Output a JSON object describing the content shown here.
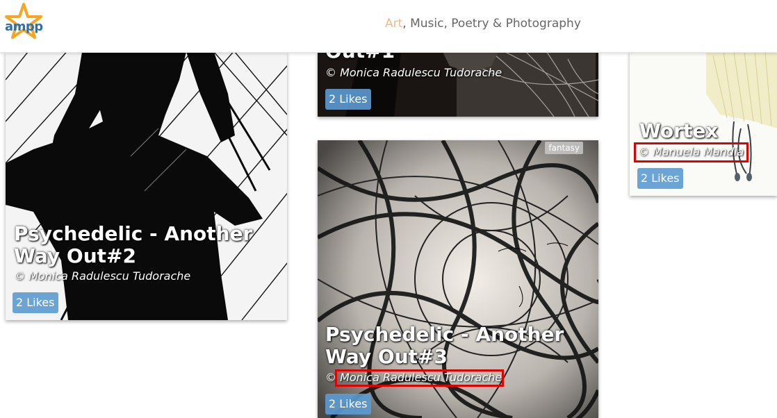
{
  "header": {
    "logo_text": "ampp",
    "nav": {
      "art": "Art",
      "separator": ",",
      "rest": " Music, Poetry & Photography"
    }
  },
  "cards": [
    {
      "title": "Psychedelic - Another Way Out#2",
      "author": "© Monica Radulescu Tudorache",
      "likes": "2 Likes"
    },
    {
      "title_fragment": "Out#1",
      "author": "© Monica Radulescu Tudorache",
      "likes": "2 Likes"
    },
    {
      "title": "Psychedelic - Another Way Out#3",
      "author": "© Monica Radulescu Tudorache",
      "likes": "2 Likes",
      "tag": "fantasy"
    },
    {
      "title": "Wortex",
      "author": "© Manuela Mandia",
      "likes": "2 Likes"
    }
  ],
  "colors": {
    "accent_art": "#f0b98b",
    "likes_button": "#5b9bd1",
    "highlight_box": "#e00000",
    "logo_blue": "#2f6ea7",
    "logo_star": "#f5a623"
  }
}
